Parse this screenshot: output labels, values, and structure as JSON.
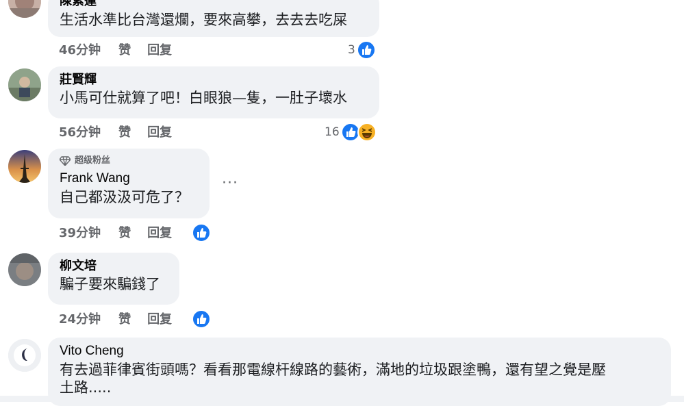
{
  "comments": [
    {
      "author": "陳紫蓮",
      "text": "生活水準比台灣還爛，要來高攀，去去去吃屎",
      "time": "46分钟",
      "like": "赞",
      "reply": "回复",
      "reaction_count": "3"
    },
    {
      "author": "莊賢輝",
      "text": "小馬可仕就算了吧！白眼狼—隻，一肚子壞水",
      "time": "56分钟",
      "like": "赞",
      "reply": "回复",
      "reaction_count": "16"
    },
    {
      "badge": "超级粉丝",
      "author": "Frank Wang",
      "text": "自己都汲汲可危了？",
      "time": "39分钟",
      "like": "赞",
      "reply": "回复",
      "more": "···"
    },
    {
      "author": "柳文培",
      "text": "騙子要來騙錢了",
      "time": "24分钟",
      "like": "赞",
      "reply": "回复"
    },
    {
      "author": "Vito Cheng",
      "text_line1": "有去過菲律賓街頭嗎？看看那電線杆線路的藝術，滿地的垃圾跟塗鴨，還有望之覺是壓",
      "text_line2": "土路....."
    }
  ],
  "colors": {
    "bubble": "#f0f2f5",
    "meta": "#65676b",
    "like_blue": "#1877f2"
  },
  "icons": [
    "like-icon",
    "haha-icon",
    "diamond-icon",
    "more-options-icon"
  ]
}
